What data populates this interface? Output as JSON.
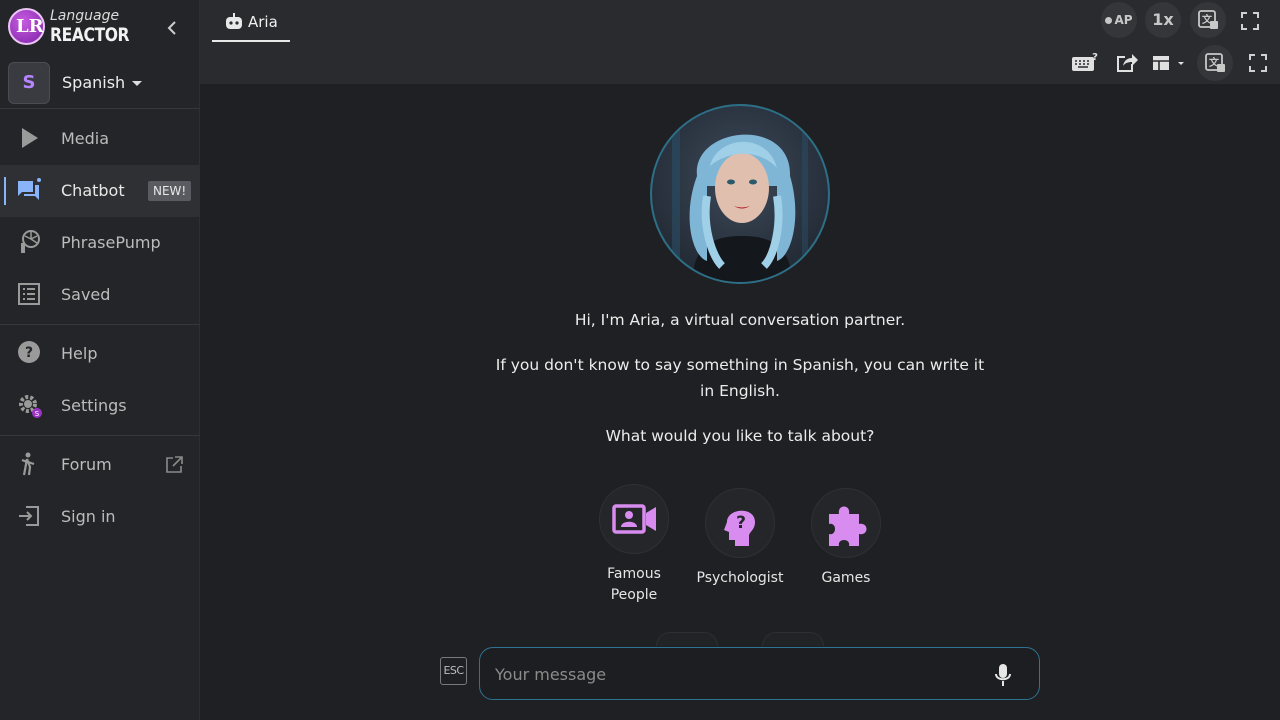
{
  "brand": {
    "line1": "Language",
    "line2": "REACTOR",
    "initials": "LR"
  },
  "language": {
    "badge": "S",
    "label": "Spanish"
  },
  "sidebar": {
    "items": [
      {
        "label": "Media"
      },
      {
        "label": "Chatbot",
        "badge": "NEW!"
      },
      {
        "label": "PhrasePump"
      },
      {
        "label": "Saved"
      },
      {
        "label": "Help"
      },
      {
        "label": "Settings"
      },
      {
        "label": "Forum"
      },
      {
        "label": "Sign in"
      }
    ]
  },
  "tab": {
    "label": "Aria"
  },
  "toolbar": {
    "ap_label": "AP",
    "speed_label": "1x"
  },
  "chat": {
    "greeting": "Hi, I'm Aria, a virtual conversation partner.",
    "hint": "If you don't know to say something in Spanish, you can write it in English.",
    "prompt": "What would you like to talk about?"
  },
  "topics": [
    {
      "label": "Famous People"
    },
    {
      "label": "Psychologist"
    },
    {
      "label": "Games"
    }
  ],
  "input": {
    "esc_label": "ESC",
    "placeholder": "Your message"
  },
  "colors": {
    "accent": "#d88cf0",
    "brand": "#9b34c6",
    "link": "#8ab4f8"
  }
}
